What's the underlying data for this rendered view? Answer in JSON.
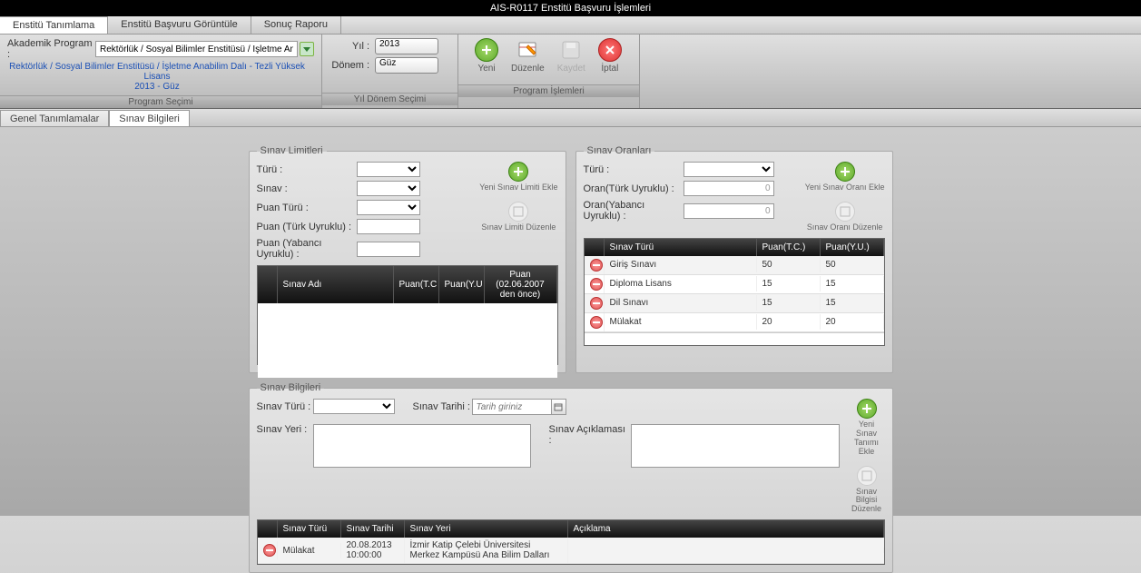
{
  "window_title": "AIS-R0117 Enstitü Başvuru İşlemleri",
  "main_tabs": [
    "Enstitü Tanımlama",
    "Enstitü Başvuru Görüntüle",
    "Sonuç Raporu"
  ],
  "ribbon": {
    "akademik_program_label": "Akademik Program :",
    "akademik_program_value": "Rektörlük / Sosyal Bilimler Enstitüsü / İşletme Anabilim D",
    "program_link": "Rektörlük / Sosyal Bilimler Enstitüsü / İşletme Anabilim Dalı - Tezli Yüksek Lisans",
    "donem_text": "2013 - Güz",
    "group1_footer": "Program Seçimi",
    "yil_label": "Yıl :",
    "yil_value": "2013",
    "donem_label": "Dönem :",
    "donem_value": "Güz",
    "group2_footer": "Yıl Dönem Seçimi",
    "btn_yeni": "Yeni",
    "btn_duzenle": "Düzenle",
    "btn_kaydet": "Kaydet",
    "btn_iptal": "İptal",
    "group3_footer": "Program İşlemleri"
  },
  "sub_tabs": [
    "Genel Tanımlamalar",
    "Sınav Bilgileri"
  ],
  "sinav_limitleri": {
    "legend": "Sınav Limitleri",
    "turu_label": "Türü :",
    "sinav_label": "Sınav :",
    "puan_turu_label": "Puan Türü :",
    "puan_turk_label": "Puan (Türk Uyruklu) :",
    "puan_yab_label": "Puan (Yabancı Uyruklu) :",
    "btn_add": "Yeni Sınav Limiti Ekle",
    "btn_edit": "Sınav Limiti Düzenle",
    "grid_cols": [
      "",
      "Sınav Adı",
      "Puan(T.C",
      "Puan(Y.U",
      "Puan (02.06.2007 den önce)"
    ]
  },
  "sinav_oranlari": {
    "legend": "Sınav Oranları",
    "turu_label": "Türü :",
    "oran_turk_label": "Oran(Türk Uyruklu) :",
    "oran_turk_value": "0",
    "oran_yab_label": "Oran(Yabancı Uyruklu) :",
    "oran_yab_value": "0",
    "btn_add": "Yeni Sınav Oranı Ekle",
    "btn_edit": "Sınav Oranı Düzenle",
    "grid_cols": [
      "",
      "Sınav Türü",
      "Puan(T.C.)",
      "Puan(Y.U.)"
    ],
    "rows": [
      {
        "tur": "Giriş Sınavı",
        "tc": "50",
        "yu": "50"
      },
      {
        "tur": "Diploma Lisans",
        "tc": "15",
        "yu": "15"
      },
      {
        "tur": "Dil Sınavı",
        "tc": "15",
        "yu": "15"
      },
      {
        "tur": "Mülakat",
        "tc": "20",
        "yu": "20"
      }
    ]
  },
  "sinav_bilgileri": {
    "legend": "Sınav Bilgileri",
    "turu_label": "Sınav Türü :",
    "tarihi_label": "Sınav Tarihi :",
    "tarihi_placeholder": "Tarih giriniz",
    "yeri_label": "Sınav Yeri :",
    "aciklama_label": "Sınav Açıklaması :",
    "btn_add": "Yeni Sınav Tanımı Ekle",
    "btn_edit": "Sınav Bilgisi Düzenle",
    "grid_cols": [
      "",
      "Sınav Türü",
      "Sınav Tarihi",
      "Sınav Yeri",
      "Açıklama"
    ],
    "rows": [
      {
        "tur": "Mülakat",
        "tarih": "20.08.2013 10:00:00",
        "yer": "İzmir Katip Çelebi Üniversitesi  Merkez Kampüsü Ana Bilim Dalları",
        "acik": ""
      }
    ]
  }
}
